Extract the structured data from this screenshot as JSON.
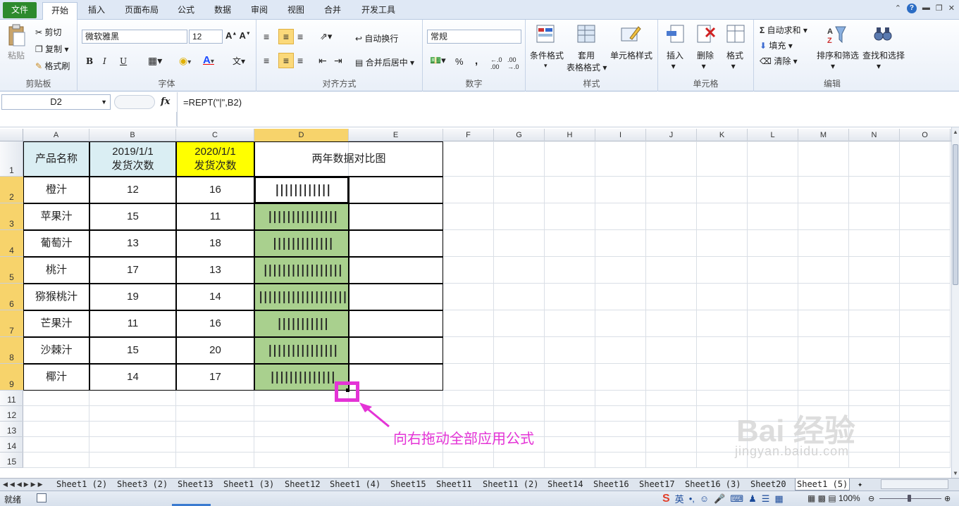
{
  "ribbon_tabs": [
    "文件",
    "开始",
    "插入",
    "页面布局",
    "公式",
    "数据",
    "审阅",
    "视图",
    "合并",
    "开发工具"
  ],
  "active_tab": "开始",
  "clipboard": {
    "paste": "粘贴",
    "cut": "剪切",
    "copy": "复制",
    "format_painter": "格式刷",
    "label": "剪贴板"
  },
  "font": {
    "name": "微软雅黑",
    "size": "12",
    "bold": "B",
    "italic": "I",
    "underline": "U",
    "label": "字体"
  },
  "alignment": {
    "wrap": "自动换行",
    "merge": "合并后居中",
    "label": "对齐方式"
  },
  "number": {
    "format": "常规",
    "percent": "%",
    "comma": ",",
    "inc": "+.0 .00",
    "dec": ".00 +.0",
    "label": "数字"
  },
  "styles": {
    "cond": "条件格式",
    "table": "套用",
    "table2": "表格格式",
    "cell": "单元格样式",
    "label": "样式"
  },
  "cells": {
    "insert": "插入",
    "delete": "删除",
    "format": "格式",
    "label": "单元格"
  },
  "editing": {
    "autosum": "自动求和",
    "fill": "填充",
    "clear": "清除",
    "sort": "排序和筛选",
    "find": "查找和选择",
    "label": "编辑"
  },
  "formula_bar": {
    "name_box": "D2",
    "fx": "fx",
    "formula": "=REPT(\"|\",B2)"
  },
  "columns": [
    "A",
    "B",
    "C",
    "D",
    "E",
    "F",
    "G",
    "H",
    "I",
    "J",
    "K",
    "L",
    "M",
    "N",
    "O"
  ],
  "rows": [
    "1",
    "2",
    "3",
    "4",
    "5",
    "6",
    "7",
    "8",
    "9",
    "11",
    "12",
    "13",
    "14",
    "15"
  ],
  "table": {
    "header": {
      "a": "产品名称",
      "b1": "2019/1/1",
      "b2": "发货次数",
      "c1": "2020/1/1",
      "c2": "发货次数",
      "d": "两年数据对比图"
    },
    "data": [
      {
        "name": "橙汁",
        "y2019": 12,
        "y2020": 16,
        "bars": "||||||||||||"
      },
      {
        "name": "苹果汁",
        "y2019": 15,
        "y2020": 11,
        "bars": "|||||||||||||||"
      },
      {
        "name": "葡萄汁",
        "y2019": 13,
        "y2020": 18,
        "bars": "|||||||||||||"
      },
      {
        "name": "桃汁",
        "y2019": 17,
        "y2020": 13,
        "bars": "|||||||||||||||||"
      },
      {
        "name": "猕猴桃汁",
        "y2019": 19,
        "y2020": 14,
        "bars": "|||||||||||||||||||"
      },
      {
        "name": "芒果汁",
        "y2019": 11,
        "y2020": 16,
        "bars": "|||||||||||"
      },
      {
        "name": "沙棘汁",
        "y2019": 15,
        "y2020": 20,
        "bars": "|||||||||||||||"
      },
      {
        "name": "椰汁",
        "y2019": 14,
        "y2020": 17,
        "bars": "||||||||||||||"
      }
    ]
  },
  "annotation": "向右拖动全部应用公式",
  "watermark": {
    "brand": "Bai  经验",
    "url": "jingyan.baidu.com"
  },
  "sheet_tabs": [
    "Sheet1 (2)",
    "Sheet3 (2)",
    "Sheet13",
    "Sheet1 (3)",
    "Sheet12",
    "Sheet1 (4)",
    "Sheet15",
    "Sheet11",
    "Sheet11 (2)",
    "Sheet14",
    "Sheet16",
    "Sheet17",
    "Sheet16 (3)",
    "Sheet20",
    "Sheet1 (5)"
  ],
  "active_sheet": "Sheet1 (5)",
  "status": {
    "ready": "就绪",
    "zoom": "100%",
    "ime": "英"
  },
  "colors": {
    "header_blue": "#daeef3",
    "header_yellow": "#ffff00",
    "bar_fill": "#a9d08e",
    "annotation": "#e433d6",
    "file_tab": "#2d8a2d"
  }
}
